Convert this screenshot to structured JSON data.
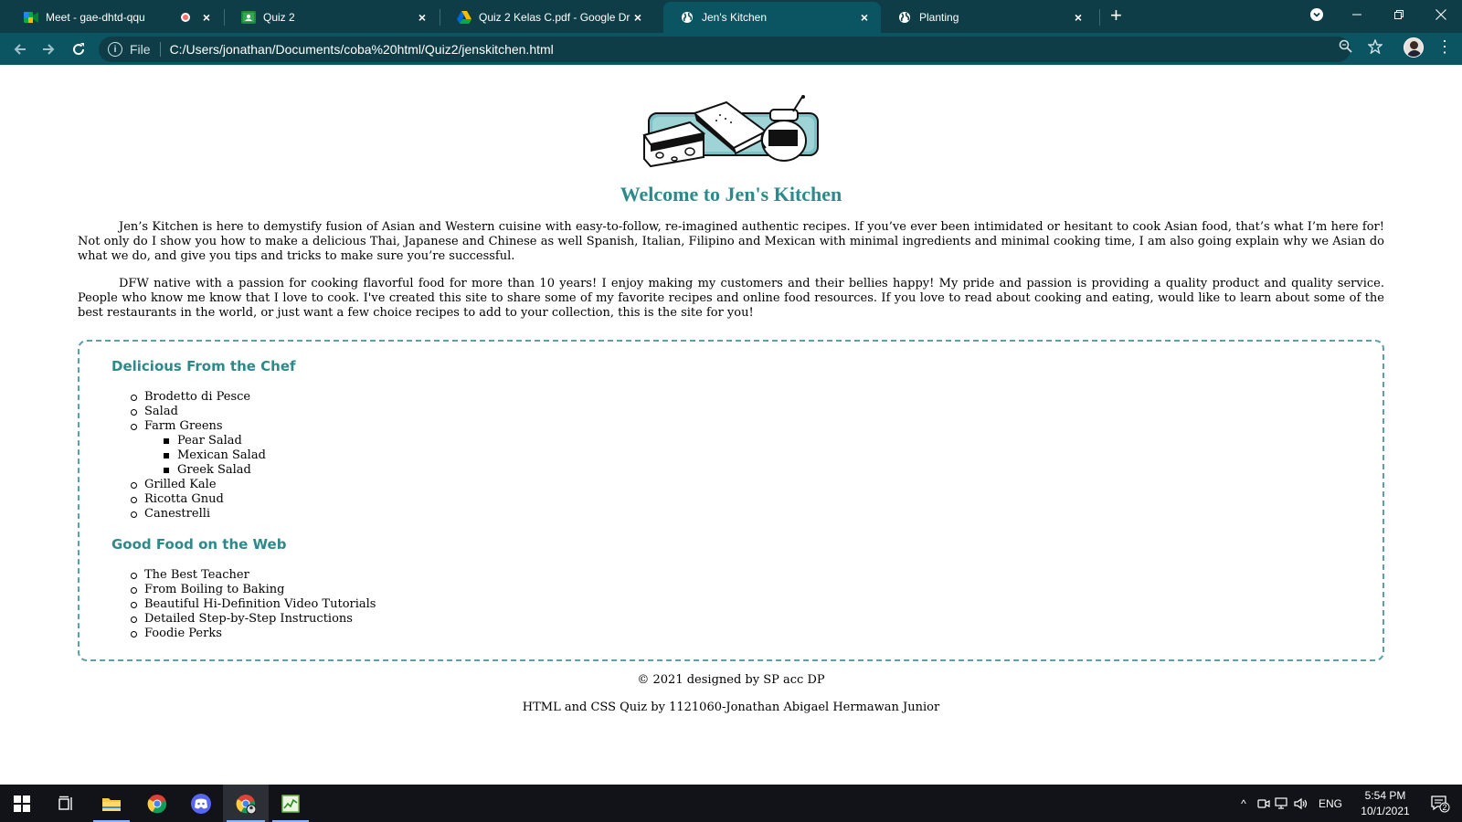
{
  "browser": {
    "tabs": [
      {
        "title": "Meet - gae-dhtd-qqu",
        "icon": "google-meet-icon",
        "recording": true
      },
      {
        "title": "Quiz 2",
        "icon": "google-classroom-icon"
      },
      {
        "title": "Quiz 2 Kelas C.pdf - Google Drive",
        "icon": "google-drive-icon"
      },
      {
        "title": "Jen's Kitchen",
        "icon": "globe-icon",
        "active": true
      },
      {
        "title": "Planting",
        "icon": "globe-icon"
      }
    ],
    "omnibox": {
      "scheme_label": "File",
      "url": "C:/Users/jonathan/Documents/coba%20html/Quiz2/jenskitchen.html"
    }
  },
  "page": {
    "heading": "Welcome to Jen's Kitchen",
    "intro_paragraphs": [
      "Jen’s Kitchen is here to demystify fusion of Asian and Western cuisine with easy-to-follow, re-imagined authentic recipes. If you’ve ever been intimidated or hesitant to cook Asian food, that’s what I’m here for! Not only do I show you how to make a delicious Thai, Japanese and Chinese as well Spanish, Italian, Filipino and Mexican with minimal ingredients and minimal cooking time, I am also going explain why we Asian do what we do, and give you tips and tricks to make sure you’re successful.",
      "DFW native with a passion for cooking flavorful food for more than 10 years! I enjoy making my customers and their bellies happy! My pride and passion is providing a quality product and quality service. People who know me know that I love to cook. I've created this site to share some of my favorite recipes and online food resources. If you love to read about cooking and eating, would like to learn about some of the best restaurants in the world, or just want a few choice recipes to add to your collection, this is the site for you!"
    ],
    "sections": [
      {
        "title": "Delicious From the Chef",
        "items": [
          {
            "label": "Brodetto di Pesce"
          },
          {
            "label": "Salad"
          },
          {
            "label": "Farm Greens",
            "children": [
              "Pear Salad",
              "Mexican Salad",
              "Greek Salad"
            ]
          },
          {
            "label": "Grilled Kale"
          },
          {
            "label": "Ricotta Gnud"
          },
          {
            "label": "Canestrelli"
          }
        ]
      },
      {
        "title": "Good Food on the Web",
        "items": [
          {
            "label": "The Best Teacher"
          },
          {
            "label": "From Boiling to Baking"
          },
          {
            "label": "Beautiful Hi-Definition Video Tutorials"
          },
          {
            "label": "Detailed Step-by-Step Instructions"
          },
          {
            "label": "Foodie Perks"
          }
        ]
      }
    ],
    "footer": {
      "copyright": "© 2021 designed by SP acc DP",
      "credit": "HTML and CSS Quiz by 1121060-Jonathan Abigael Hermawan Junior"
    },
    "accent_color": "#2c8a8a"
  },
  "taskbar": {
    "tray": {
      "language": "ENG",
      "time": "5:54 PM",
      "date": "10/1/2021",
      "notification_count": "2"
    }
  }
}
